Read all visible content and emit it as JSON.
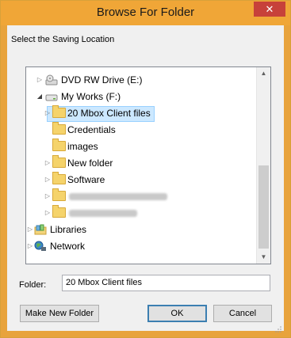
{
  "window": {
    "title": "Browse For Folder",
    "close_glyph": "✕"
  },
  "prompt": "Select the Saving Location",
  "tree": {
    "items": [
      {
        "label": "DVD RW Drive (E:)",
        "icon": "dvd-drive-icon",
        "expander": "collapsed"
      },
      {
        "label": "My Works (F:)",
        "icon": "hard-drive-icon",
        "expander": "expanded"
      },
      {
        "label": "20 Mbox Client files",
        "icon": "folder-icon",
        "expander": "collapsed",
        "selected": true
      },
      {
        "label": "Credentials",
        "icon": "folder-icon",
        "expander": "none"
      },
      {
        "label": "images",
        "icon": "folder-icon",
        "expander": "none"
      },
      {
        "label": "New folder",
        "icon": "folder-icon",
        "expander": "collapsed"
      },
      {
        "label": "Software",
        "icon": "folder-icon",
        "expander": "collapsed"
      },
      {
        "label": "",
        "icon": "folder-icon",
        "expander": "collapsed",
        "redacted": true
      },
      {
        "label": "",
        "icon": "folder-icon",
        "expander": "collapsed",
        "redacted": true
      },
      {
        "label": "Libraries",
        "icon": "libraries-icon",
        "expander": "collapsed"
      },
      {
        "label": "Network",
        "icon": "network-icon",
        "expander": "collapsed"
      }
    ]
  },
  "folder_field": {
    "label": "Folder:",
    "value": "20 Mbox Client files"
  },
  "buttons": {
    "make_new_folder": "Make New Folder",
    "ok": "OK",
    "cancel": "Cancel"
  },
  "colors": {
    "title_bar": "#f0a637",
    "close_button": "#c7413a",
    "selection": "#cce8ff"
  }
}
